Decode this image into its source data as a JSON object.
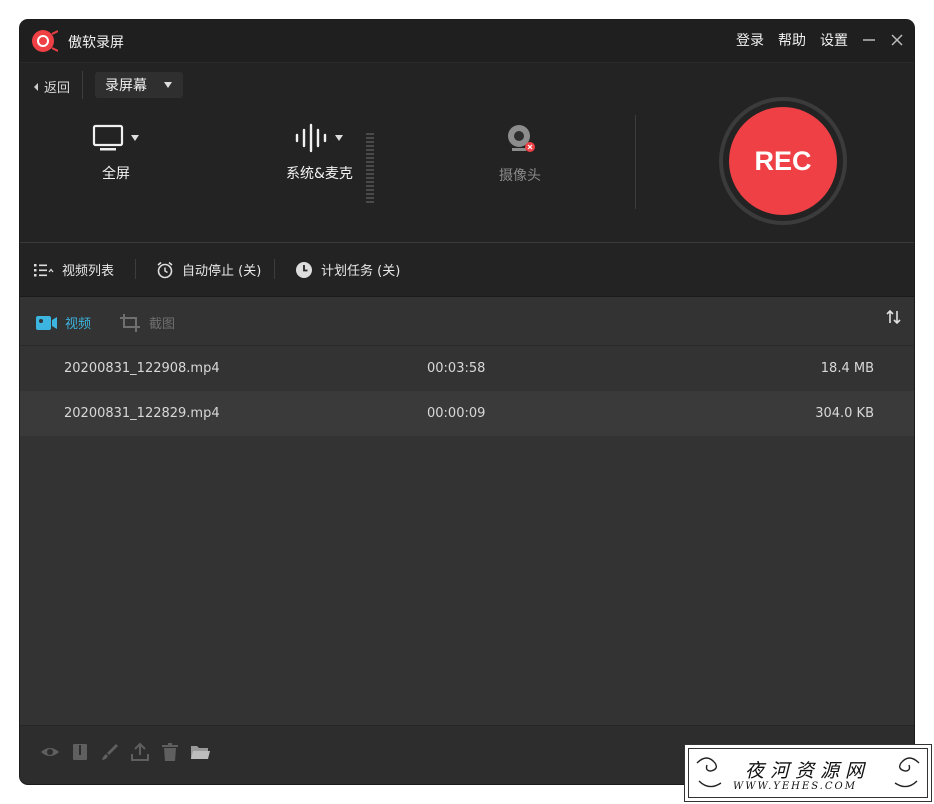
{
  "app": {
    "title": "傲软录屏"
  },
  "header": {
    "login": "登录",
    "help": "帮助",
    "settings": "设置"
  },
  "control": {
    "back": "返回",
    "mode": "录屏幕",
    "sources": [
      {
        "label": "全屏",
        "icon": "monitor-icon"
      },
      {
        "label": "系统&麦克",
        "icon": "audio-wave-icon"
      },
      {
        "label": "摄像头",
        "icon": "webcam-icon"
      }
    ],
    "rec": "REC"
  },
  "toolbar": {
    "video_list": "视频列表",
    "auto_stop": "自动停止 (关)",
    "schedule": "计划任务 (关)"
  },
  "tabs": {
    "video": "视频",
    "screenshot": "截图"
  },
  "files": [
    {
      "name": "20200831_122908.mp4",
      "duration": "00:03:58",
      "size": "18.4 MB"
    },
    {
      "name": "20200831_122829.mp4",
      "duration": "00:00:09",
      "size": "304.0 KB"
    }
  ],
  "colors": {
    "rec": "#ef4045",
    "accent": "#3cb5e0",
    "background": "#333333"
  },
  "watermark": {
    "title": "夜河资源网",
    "url": "WWW.YEHES.COM"
  }
}
